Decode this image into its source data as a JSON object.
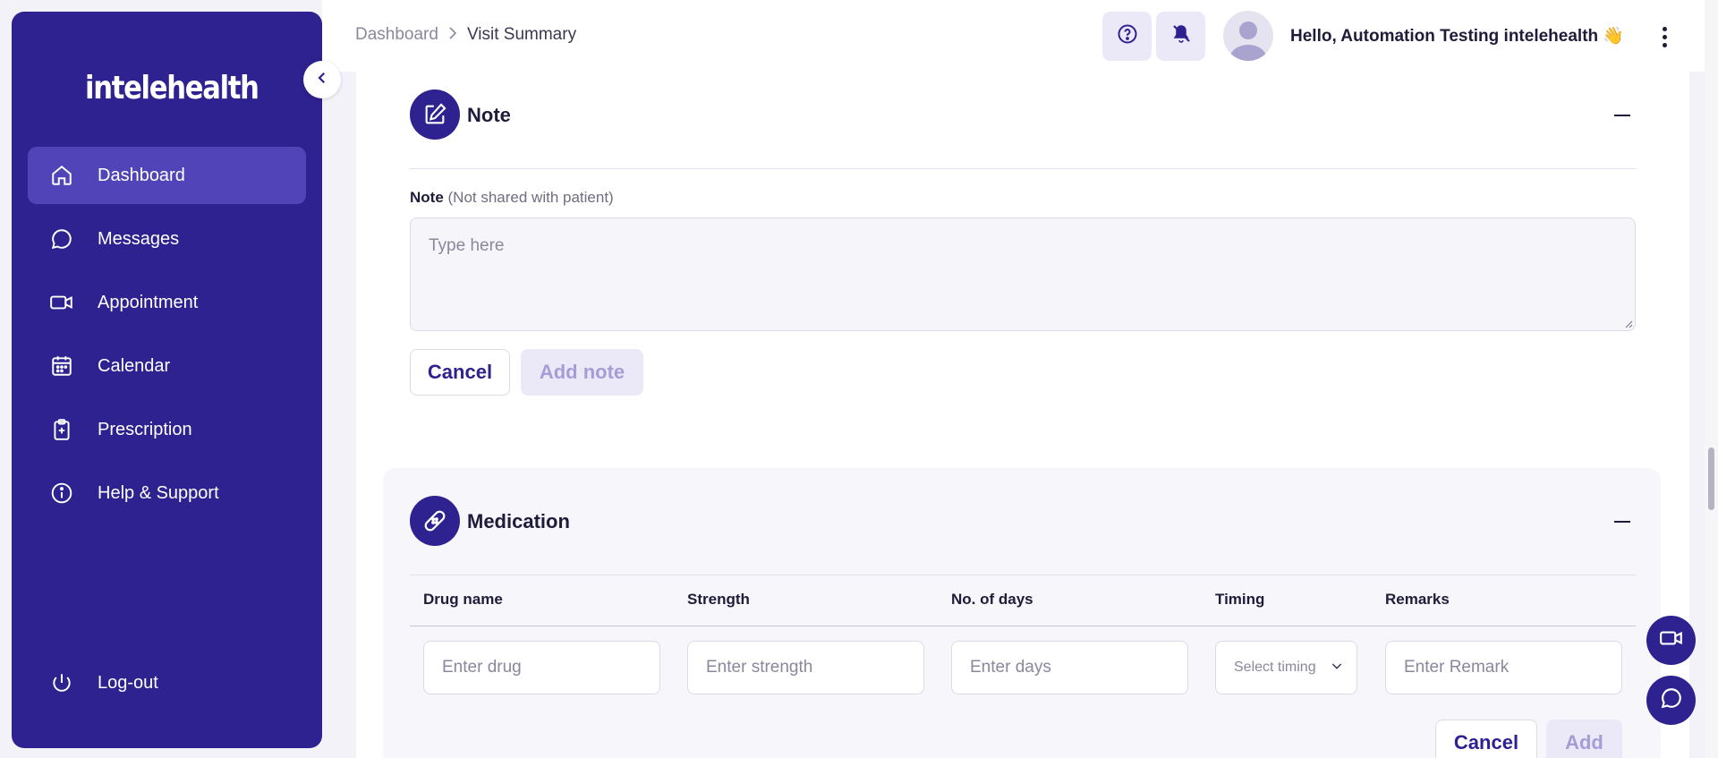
{
  "app": {
    "brand": "intelehealth"
  },
  "sidebar": {
    "items": [
      {
        "label": "Dashboard",
        "icon": "home-icon",
        "active": true
      },
      {
        "label": "Messages",
        "icon": "chat-icon"
      },
      {
        "label": "Appointment",
        "icon": "video-icon"
      },
      {
        "label": "Calendar",
        "icon": "calendar-icon"
      },
      {
        "label": "Prescription",
        "icon": "clipboard-icon"
      },
      {
        "label": "Help & Support",
        "icon": "info-icon"
      }
    ],
    "logout": "Log-out"
  },
  "header": {
    "breadcrumb": {
      "parent": "Dashboard",
      "current": "Visit Summary"
    },
    "greeting": "Hello, Automation Testing intelehealth",
    "wave": "👋"
  },
  "note": {
    "title": "Note",
    "label": "Note",
    "sublabel": "(Not shared with patient)",
    "placeholder": "Type here",
    "cancel": "Cancel",
    "add": "Add note"
  },
  "medication": {
    "title": "Medication",
    "columns": [
      "Drug name",
      "Strength",
      "No. of days",
      "Timing",
      "Remarks"
    ],
    "placeholders": {
      "drug": "Enter drug",
      "strength": "Enter strength",
      "days": "Enter days",
      "timing": "Select timing",
      "remark": "Enter Remark"
    },
    "cancel": "Cancel",
    "add": "Add"
  },
  "colors": {
    "primary": "#2e2190",
    "primary_light": "#5144b8",
    "tint": "#ebe8f8"
  }
}
